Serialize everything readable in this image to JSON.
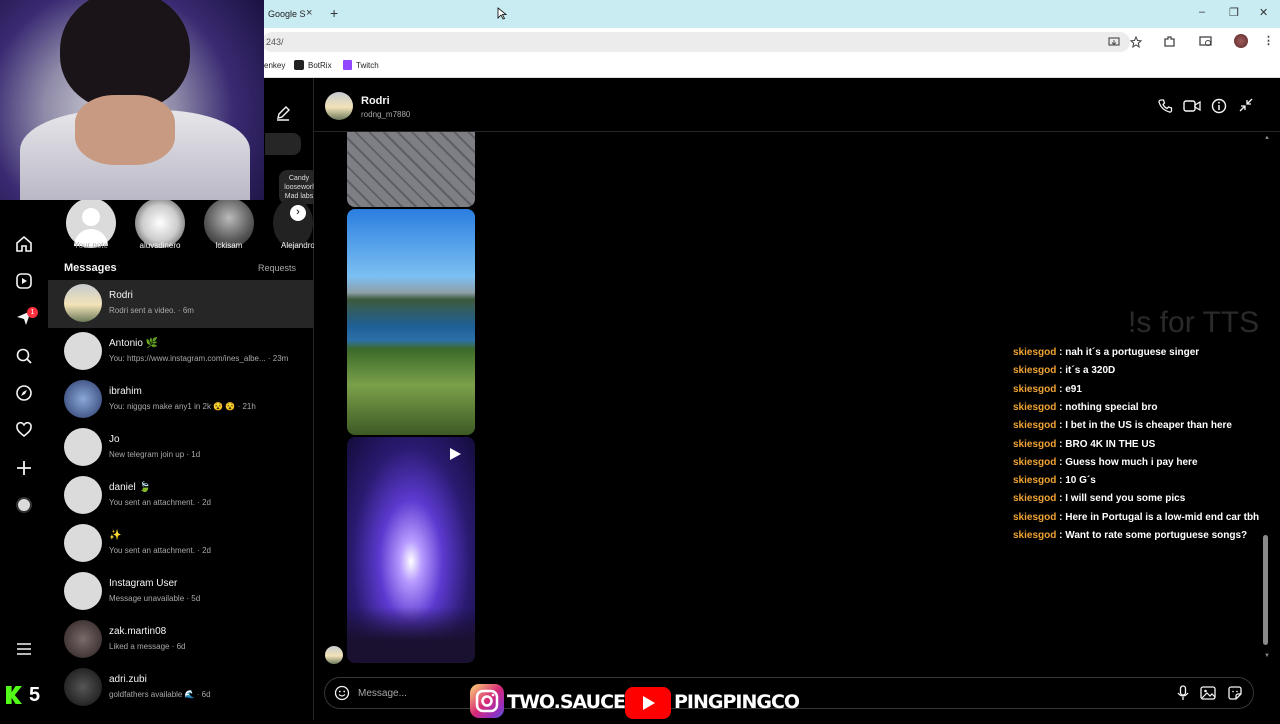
{
  "browser": {
    "tab_label": "Google S",
    "tab_close": "×",
    "new_tab": "+",
    "address": "243/",
    "bookmarks": [
      {
        "label": "enkey",
        "icon": ""
      },
      {
        "label": "BotRix",
        "icon": "botrix-icon"
      },
      {
        "label": "Twitch",
        "icon": "twitch-icon"
      }
    ],
    "window_controls": [
      "–",
      "❐",
      "✕"
    ]
  },
  "notes": [
    {
      "name": "Your note"
    },
    {
      "name": "aluvsdinero"
    },
    {
      "name": "lckisam"
    },
    {
      "name": "Alejandro"
    }
  ],
  "note_bubble": "Candy\nlooseworl\nMad labs",
  "inbox": {
    "title": "Messages",
    "requests": "Requests",
    "conversations": [
      {
        "name": "Rodri",
        "sub": "Rodri sent a video. · 6m",
        "active": true
      },
      {
        "name": "Antonio 🌿",
        "sub": "You: https://www.instagram.com/ines_albe... · 23m"
      },
      {
        "name": "ibrahim",
        "sub": "You: niggqs make any1 in 2k 😵 😵 · 21h"
      },
      {
        "name": "Jo",
        "sub": "New telegram join up · 1d"
      },
      {
        "name": "daniel 🍃",
        "sub": "You sent an attachment. · 2d"
      },
      {
        "name": "✨",
        "sub": "You sent an attachment. · 2d"
      },
      {
        "name": "Instagram User",
        "sub": "Message unavailable · 5d"
      },
      {
        "name": "zak.martin08",
        "sub": "Liked a message · 6d"
      },
      {
        "name": "adri.zubi",
        "sub": "goldfathers available 🌊 · 6d"
      }
    ]
  },
  "nav": {
    "badge": "1"
  },
  "chat": {
    "name": "Rodri",
    "username": "rodng_m7880",
    "message_placeholder": "Message..."
  },
  "stream_overlay": {
    "title": "!s for TTS",
    "lines": [
      {
        "user": "skiesgod",
        "msg": ": nah it´s a portuguese singer"
      },
      {
        "user": "skiesgod",
        "msg": ": it´s a 320D"
      },
      {
        "user": "skiesgod",
        "msg": ": e91"
      },
      {
        "user": "skiesgod",
        "msg": ": nothing special bro"
      },
      {
        "user": "skiesgod",
        "msg": ": I bet in the US is cheaper than here"
      },
      {
        "user": "skiesgod",
        "msg": ": BRO 4K IN THE US"
      },
      {
        "user": "skiesgod",
        "msg": ": Guess how much i pay here"
      },
      {
        "user": "skiesgod",
        "msg": ": 10 G´s"
      },
      {
        "user": "skiesgod",
        "msg": ": I will send you some pics"
      },
      {
        "user": "skiesgod",
        "msg": ": Here in Portugal is a low-mid end car tbh"
      },
      {
        "user": "skiesgod",
        "msg": ": Want to rate some portuguese songs?"
      }
    ],
    "instagram_handle": "TWO.SAUCED",
    "youtube_handle": "PINGPINGCO",
    "kick_count": "5"
  },
  "colors": {
    "accent_user": "#f0a334",
    "bg": "#000000",
    "tab_bar": "#c9ecf3"
  }
}
